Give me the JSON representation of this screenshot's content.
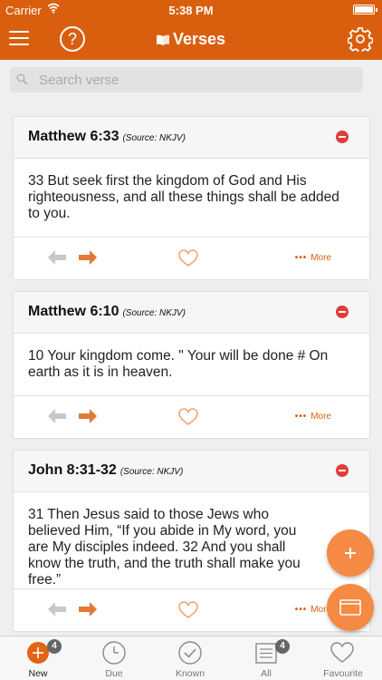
{
  "status": {
    "carrier": "Carrier",
    "time": "5:38 PM"
  },
  "nav": {
    "title": "Verses",
    "help": "?"
  },
  "search": {
    "placeholder": "Search verse"
  },
  "cards": [
    {
      "ref": "Matthew 6:33",
      "source": "(Source: NKJV)",
      "text": "33 But seek first the kingdom of God and His righteousness, and all these things shall be added to you.",
      "more": "More"
    },
    {
      "ref": "Matthew 6:10",
      "source": "(Source: NKJV)",
      "text": "10 Your kingdom come. \" Your will be done # On earth as it is in heaven.",
      "more": "More"
    },
    {
      "ref": "John 8:31-32",
      "source": "(Source: NKJV)",
      "text": "31 Then Jesus said to those Jews who believed Him, “If you abide in My word, you are My disciples indeed. 32 And you shall know the truth, and the truth shall make you free.”",
      "more": "More"
    }
  ],
  "tabs": [
    {
      "label": "New",
      "badge": "4"
    },
    {
      "label": "Due"
    },
    {
      "label": "Known"
    },
    {
      "label": "All",
      "badge": "4"
    },
    {
      "label": "Favourite"
    }
  ],
  "colors": {
    "accent": "#d95f0e",
    "fab": "#f58a45",
    "remove": "#e33b3b"
  }
}
